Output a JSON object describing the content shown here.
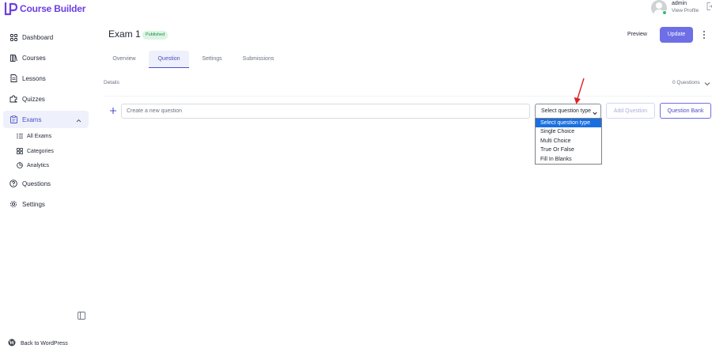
{
  "app": {
    "name": "Course Builder"
  },
  "sidebar": {
    "items": [
      {
        "label": "Dashboard",
        "icon": "dashboard-icon"
      },
      {
        "label": "Courses",
        "icon": "book-icon"
      },
      {
        "label": "Lessons",
        "icon": "document-icon"
      },
      {
        "label": "Quizzes",
        "icon": "puzzle-icon"
      },
      {
        "label": "Exams",
        "icon": "clipboard-icon",
        "active": true
      },
      {
        "label": "Questions",
        "icon": "help-circle-icon"
      },
      {
        "label": "Settings",
        "icon": "gear-icon"
      }
    ],
    "exam_sub": [
      {
        "label": "All Exams",
        "icon": "list-icon"
      },
      {
        "label": "Categories",
        "icon": "grid-icon"
      },
      {
        "label": "Analytics",
        "icon": "pie-chart-icon"
      }
    ],
    "back_label": "Back to WordPress"
  },
  "user": {
    "name": "admin",
    "link": "View Profile"
  },
  "header": {
    "title": "Exam 1",
    "status": "Published",
    "preview_label": "Preview",
    "update_label": "Update"
  },
  "tabs": [
    {
      "label": "Overview"
    },
    {
      "label": "Question",
      "active": true
    },
    {
      "label": "Settings"
    },
    {
      "label": "Submissions"
    }
  ],
  "details": {
    "label": "Details",
    "count_text": "0 Questions"
  },
  "create_row": {
    "placeholder": "Create a new question",
    "type_value": "Select question type",
    "add_label": "Add Question",
    "bank_label": "Question Bank"
  },
  "type_options": [
    "Select question type",
    "Single Choice",
    "Multi Choice",
    "True Or False",
    "Fill In Blanks"
  ],
  "colors": {
    "brand": "#6b3fe0",
    "accent": "#6e6ee6",
    "active_nav_bg": "#eef0fb",
    "published_bg": "#dcf5e3",
    "published_text": "#1e8a4c",
    "dropdown_selected": "#1a6fe0",
    "annotation": "#e02020"
  }
}
